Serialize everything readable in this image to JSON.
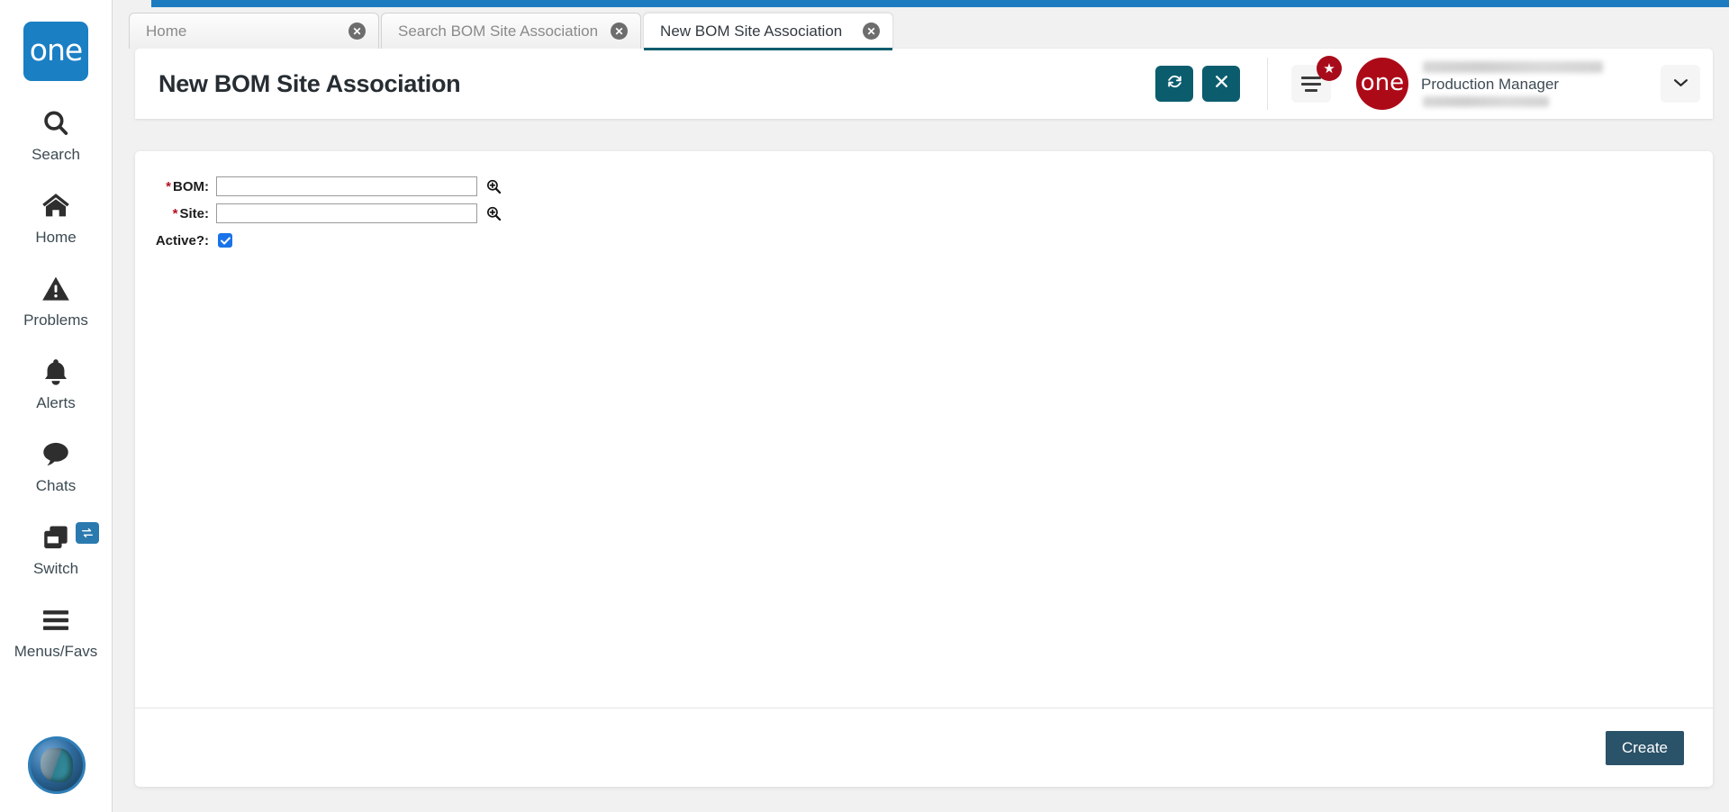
{
  "app": {
    "brand_logo_text": "one",
    "top_bar_color": "#1d7cc0",
    "accent_teal": "#0b5d6e",
    "brand_blue": "#1b7fc4",
    "org_red": "#ad0a18",
    "create_button_color": "#2a5269"
  },
  "sidebar": {
    "items": [
      {
        "label": "Search",
        "icon": "search-icon"
      },
      {
        "label": "Home",
        "icon": "home-icon"
      },
      {
        "label": "Problems",
        "icon": "warning-triangle-icon"
      },
      {
        "label": "Alerts",
        "icon": "bell-icon"
      },
      {
        "label": "Chats",
        "icon": "chat-bubble-icon"
      },
      {
        "label": "Switch",
        "icon": "switch-windows-icon",
        "badge_icon": "swap-arrows-icon"
      },
      {
        "label": "Menus/Favs",
        "icon": "hamburger-icon"
      }
    ],
    "avatar": {
      "icon": "user-avatar-image"
    }
  },
  "tabs": [
    {
      "label": "Home",
      "active": false,
      "close_icon": "close-circle-icon"
    },
    {
      "label": "Search BOM Site Association",
      "active": false,
      "close_icon": "close-circle-icon"
    },
    {
      "label": "New BOM Site Association",
      "active": true,
      "close_icon": "close-circle-icon"
    }
  ],
  "header": {
    "title": "New BOM Site Association",
    "refresh_icon": "refresh-icon",
    "close_icon": "close-x-icon",
    "menu_icon": "hamburger-menu-icon",
    "star_badge_icon": "star-icon",
    "org_logo_text": "one",
    "user_role": "Production Manager",
    "user_name_redacted": true,
    "user_org_redacted": true,
    "caret_icon": "chevron-down-icon"
  },
  "form": {
    "fields": [
      {
        "label": "BOM",
        "required": true,
        "value": "",
        "placeholder": "",
        "type": "lookup",
        "lookup_icon": "magnifier-plus-icon"
      },
      {
        "label": "Site",
        "required": true,
        "value": "",
        "placeholder": "",
        "type": "lookup",
        "lookup_icon": "magnifier-plus-icon"
      },
      {
        "label": "Active?",
        "required": false,
        "value": "checked",
        "type": "checkbox",
        "check_icon": "checkmark-icon"
      }
    ]
  },
  "footer": {
    "create_label": "Create"
  }
}
